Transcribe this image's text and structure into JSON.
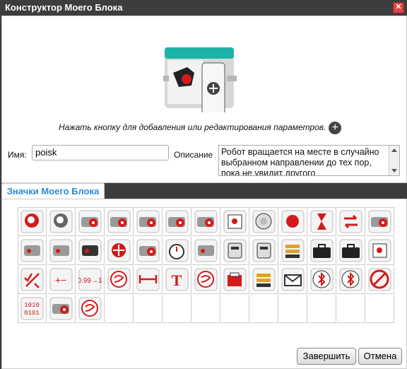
{
  "window": {
    "title": "Конструктор Моего Блока",
    "close_icon": "close-icon"
  },
  "editor": {
    "hint": "Нажать кнопку для добавления или редактирования параметров.",
    "name_label": "Имя:",
    "name_value": "poisk",
    "desc_label": "Описание",
    "desc_value": "Робот вращается на месте в случайно выбранном направлении до тех пор, пока не увидит другого"
  },
  "tab": {
    "label": "Значки Моего Блока"
  },
  "icons": [
    "brain-head-icon",
    "brain-head-gray-icon",
    "large-motor-icon",
    "medium-motor-icon",
    "move-steering-icon",
    "move-steering-wheel-icon",
    "move-tank-icon",
    "display-icon",
    "sound-icon",
    "brick-status-light-icon",
    "timer-hourglass-icon",
    "loop-interrupt-icon",
    "unregulated-motor-icon",
    "ultrasonic-sensor-icon",
    "color-sensor-icon",
    "infrared-sensor-icon",
    "gyro-direction-icon",
    "motor-rotation-icon",
    "stopwatch-icon",
    "touch-sensor-icon",
    "ir-beacon-icon",
    "battery-temp-sensor-icon",
    "data-log-icon",
    "case-icon",
    "locked-case-icon",
    "number-display-icon",
    "logic-check-icon",
    "math-operators-icon",
    "round-number-icon",
    "random-icon",
    "range-arrows-icon",
    "text-t-icon",
    "dice-random-icon",
    "file-access-icon",
    "data-logging-chart-icon",
    "messaging-envelope-icon",
    "bluetooth-icon",
    "bluetooth-settings-icon",
    "stop-wireless-icon",
    "binary-icon",
    "motor-rotation-sensor-icon",
    "random-wave-icon"
  ],
  "buttons": {
    "finish": "Завершить",
    "cancel": "Отмена"
  }
}
